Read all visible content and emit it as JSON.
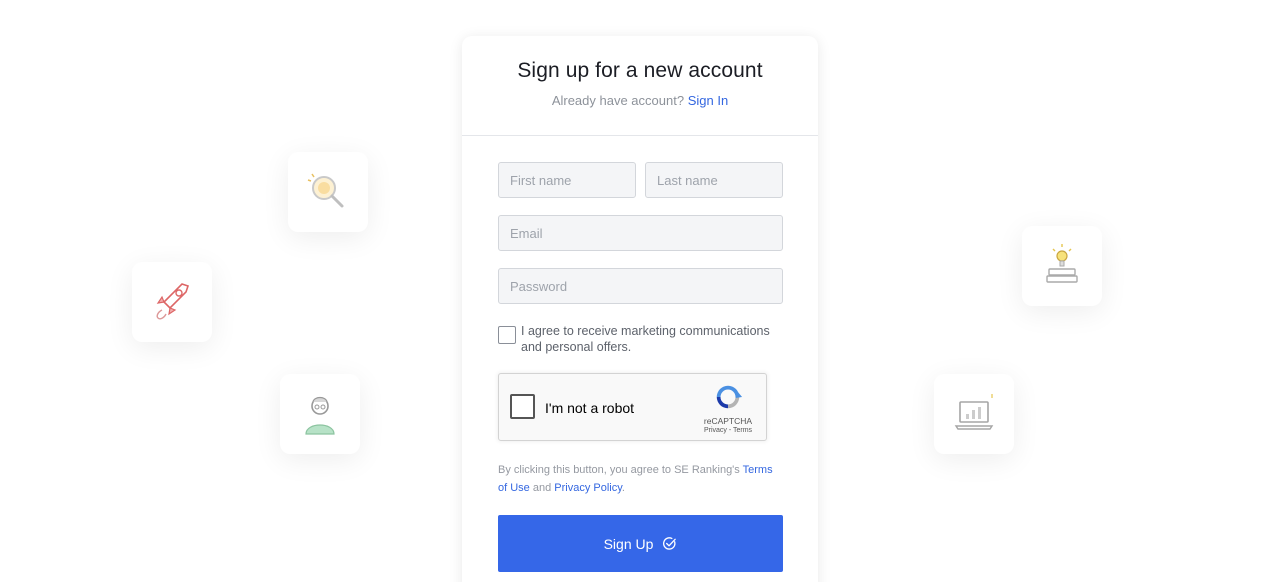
{
  "header": {
    "title": "Sign up for a new account",
    "already_text": "Already have account?",
    "signin_link": "Sign In"
  },
  "form": {
    "first_name_placeholder": "First name",
    "last_name_placeholder": "Last name",
    "email_placeholder": "Email",
    "password_placeholder": "Password",
    "agree_line1": "I agree to receive marketing communications",
    "agree_line2": "and personal offers."
  },
  "captcha": {
    "label": "I'm not a robot",
    "brand": "reCAPTCHA",
    "privacy": "Privacy",
    "separator": " - ",
    "terms": "Terms"
  },
  "legal": {
    "prefix": "By clicking this button, you agree to SE Ranking's ",
    "terms_link": "Terms of Use",
    "and": " and ",
    "privacy_link": "Privacy Policy",
    "suffix": "."
  },
  "submit": {
    "label": "Sign Up",
    "icon": "check-circle-icon"
  },
  "background_icons": [
    "seo-magnifier-icon",
    "rocket-icon",
    "person-icon",
    "lightbulb-books-icon",
    "laptop-chart-icon"
  ],
  "colors": {
    "accent": "#3567e8",
    "link": "#3467e0",
    "title": "#1b1d24",
    "muted": "#8d929a"
  }
}
